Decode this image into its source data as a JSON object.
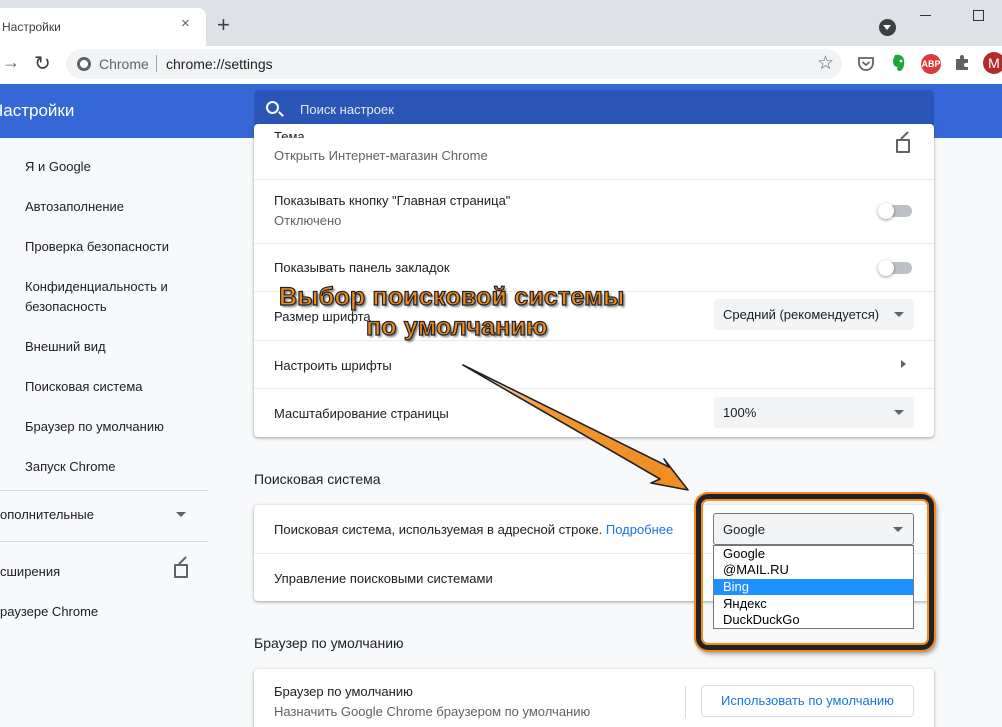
{
  "browser": {
    "tab_title": "Настройки",
    "tab_close": "×",
    "new_tab": "+",
    "back": "←",
    "forward": "→",
    "reload": "↻",
    "chip_label": "Chrome",
    "url": "chrome://settings",
    "star": "☆",
    "ext_abp": "ABP",
    "avatar_letter": "M"
  },
  "header": {
    "title": "Настройки",
    "search_placeholder": "Поиск настроек"
  },
  "sidebar": {
    "items": [
      {
        "label": "Я и Google"
      },
      {
        "label": "Автозаполнение"
      },
      {
        "label": "Проверка безопасности"
      },
      {
        "label": "Конфиденциальность и"
      },
      {
        "label": "безопасность"
      },
      {
        "label": "Внешний вид"
      },
      {
        "label": "Поисковая система"
      },
      {
        "label": "Браузер по умолчанию"
      },
      {
        "label": "Запуск Chrome"
      }
    ],
    "advanced": "ополнительные",
    "extensions": "сширения",
    "about": "раузере Chrome"
  },
  "appearance": {
    "theme_partial": "Тема",
    "theme_sub": "Открыть Интернет-магазин Chrome",
    "home_button_label": "Показывать кнопку \"Главная страница\"",
    "home_button_sub": "Отключено",
    "bookmarks_bar_label": "Показывать панель закладок",
    "font_size_label": "Размер шрифта",
    "font_size_value": "Средний (рекомендуется)",
    "customize_fonts_label": "Настроить шрифты",
    "page_zoom_label": "Масштабирование страницы",
    "page_zoom_value": "100%"
  },
  "search_engine": {
    "section_title": "Поисковая система",
    "address_bar_label": "Поисковая система, используемая в адресной строке.",
    "learn_more": "Подробнее",
    "selected": "Google",
    "options": [
      "Google",
      "@MAIL.RU",
      "Bing",
      "Яндекс",
      "DuckDuckGo"
    ],
    "highlighted_option": "Bing",
    "manage_label": "Управление поисковыми системами"
  },
  "default_browser": {
    "section_title": "Браузер по умолчанию",
    "row_label": "Браузер по умолчанию",
    "row_sub": "Назначить Google Chrome браузером по умолчанию",
    "button": "Использовать по умолчанию"
  },
  "annotation": {
    "line1": "Выбор поисковой системы",
    "line2": "по умолчанию"
  },
  "colors": {
    "header_blue": "#3567d6",
    "annotation_orange": "#f08c1f",
    "dropdown_highlight": "#1e90ff",
    "link_blue": "#1a73e8"
  }
}
